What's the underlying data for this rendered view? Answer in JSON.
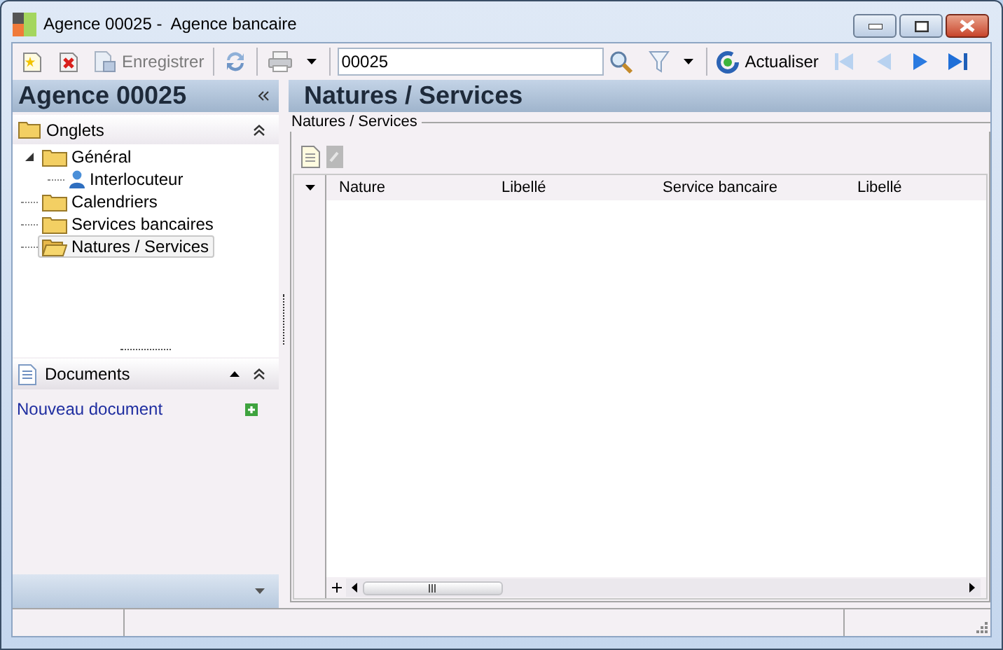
{
  "window": {
    "title": "Agence 00025 -  Agence bancaire"
  },
  "toolbar": {
    "save_label": "Enregistrer",
    "search_value": "00025",
    "refresh_label": "Actualiser"
  },
  "sidebar": {
    "title": "Agence 00025",
    "tabs_title": "Onglets",
    "tree": [
      {
        "label": "Général",
        "selected": false,
        "children": [
          {
            "label": "Interlocuteur",
            "selected": false
          }
        ]
      },
      {
        "label": "Calendriers",
        "selected": false
      },
      {
        "label": "Services bancaires",
        "selected": false
      },
      {
        "label": "Natures / Services",
        "selected": true
      }
    ],
    "documents_title": "Documents",
    "documents_link": "Nouveau document"
  },
  "main": {
    "title": "Natures / Services",
    "group_label": "Natures / Services",
    "table": {
      "columns": [
        "Nature",
        "Libellé",
        "Service bancaire",
        "Libellé"
      ]
    }
  }
}
